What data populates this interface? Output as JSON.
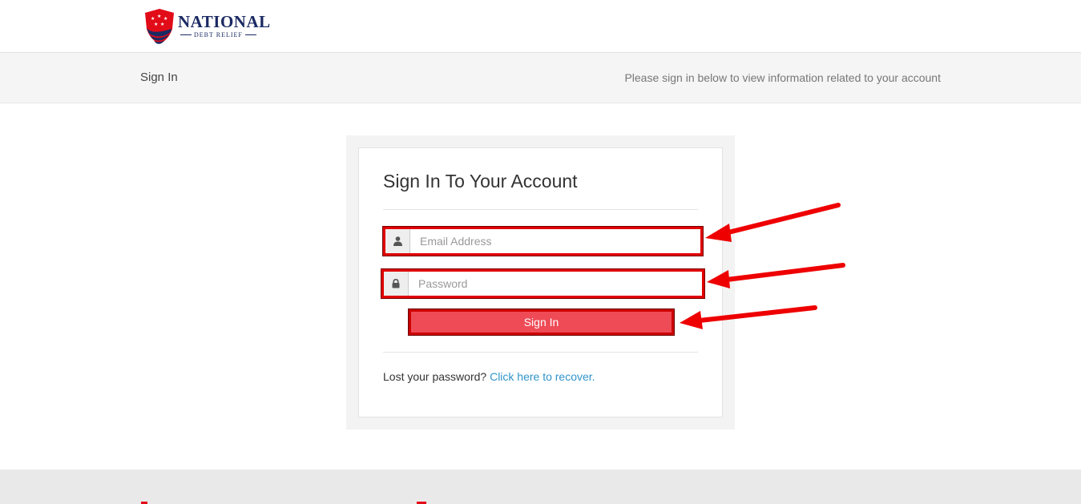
{
  "brand": {
    "name": "NATIONAL",
    "tagline": "DEBT RELIEF",
    "colors": {
      "navy": "#1b2a63",
      "red": "#e20b18"
    }
  },
  "subbar": {
    "title": "Sign In",
    "description": "Please sign in below to view information related to your account"
  },
  "login": {
    "heading": "Sign In To Your Account",
    "email": {
      "placeholder": "Email Address",
      "value": "",
      "icon": "user-icon"
    },
    "password": {
      "placeholder": "Password",
      "value": "",
      "icon": "lock-icon"
    },
    "submit_label": "Sign In",
    "recover_prompt": "Lost your password?",
    "recover_link": "Click here to recover."
  },
  "annotations": {
    "arrow_color": "#ee0000",
    "highlight_color": "#e00000"
  }
}
